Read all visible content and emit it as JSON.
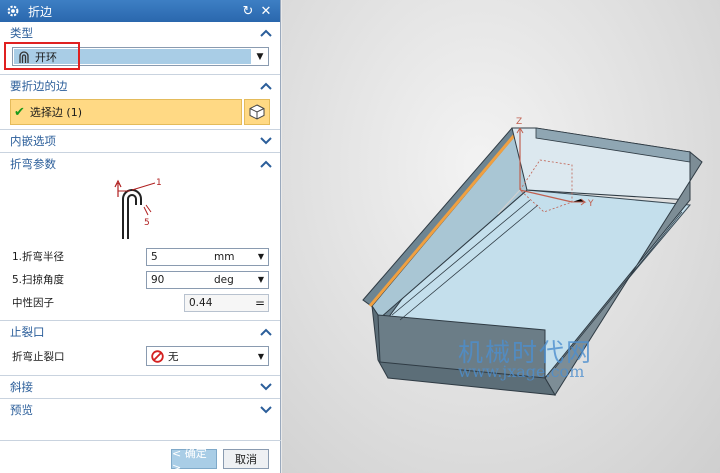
{
  "dialog": {
    "title": "折边",
    "icon": "gear-icon"
  },
  "type_section": {
    "header": "类型",
    "selected": "开环"
  },
  "edge_section": {
    "header": "要折边的边",
    "selection": "选择边 (1)"
  },
  "inset_section": {
    "header": "内嵌选项"
  },
  "bend_section": {
    "header": "折弯参数",
    "diagram_labels": {
      "one": "1",
      "five": "5"
    },
    "rows": [
      {
        "label": "1.折弯半径",
        "value": "5",
        "unit": "mm"
      },
      {
        "label": "5.扫掠角度",
        "value": "90",
        "unit": "deg"
      }
    ],
    "neutral": {
      "label": "中性因子",
      "value": "0.44"
    }
  },
  "relief_section": {
    "header": "止裂口",
    "label": "折弯止裂口",
    "value": "无"
  },
  "miter_section": {
    "header": "斜接"
  },
  "preview_section": {
    "header": "预览"
  },
  "buttons": {
    "ok": "< 确定 >",
    "cancel": "取消"
  },
  "viewport": {
    "axis_z": "Z",
    "axis_y": "Y",
    "watermark_cn": "机械时代网",
    "watermark_url": "www.jxage.com"
  },
  "colors": {
    "accent": "#2b5e9a",
    "selection": "#ffd984",
    "highlight_edge": "#f0a040",
    "part": "#b9d7e6"
  }
}
